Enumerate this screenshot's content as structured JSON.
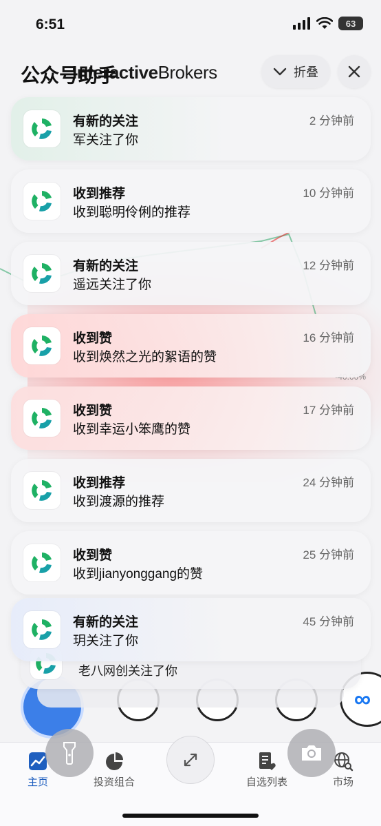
{
  "status_bar": {
    "time": "6:51",
    "battery": "63"
  },
  "background_app": {
    "brand_prefix": "Inter",
    "brand_bold": "active",
    "brand_suffix": "Brokers",
    "percent_label": "-40.00%",
    "meta_logo": "∞"
  },
  "header": {
    "title": "公众号助手",
    "collapse_label": "折叠",
    "collapse_icon": "chevron-down-icon",
    "close_icon": "close-icon"
  },
  "notifications": [
    {
      "title": "有新的关注",
      "body": "军关注了你",
      "time": "2 分钟前"
    },
    {
      "title": "收到推荐",
      "body": "收到聪明伶俐的推荐",
      "time": "10 分钟前"
    },
    {
      "title": "有新的关注",
      "body": "遥远关注了你",
      "time": "12 分钟前"
    },
    {
      "title": "收到赞",
      "body": "收到焕然之光的絮语的赞",
      "time": "16 分钟前"
    },
    {
      "title": "收到赞",
      "body": "收到幸运小笨鹰的赞",
      "time": "17 分钟前"
    },
    {
      "title": "收到推荐",
      "body": "收到渡源的推荐",
      "time": "24 分钟前"
    },
    {
      "title": "收到赞",
      "body": "收到jianyonggang的赞",
      "time": "25 分钟前"
    },
    {
      "title": "有新的关注",
      "body": "玥关注了你",
      "time": "45 分钟前"
    }
  ],
  "stacked": [
    {
      "body": "老八网创关注了你"
    }
  ],
  "tab_bar": {
    "tabs": [
      {
        "label": "主页",
        "icon": "chart-trend-icon",
        "active": true
      },
      {
        "label": "投资组合",
        "icon": "pie-chart-icon",
        "active": false
      },
      {
        "label": "自选列表",
        "icon": "watchlist-icon",
        "active": false
      },
      {
        "label": "市场",
        "icon": "globe-search-icon",
        "active": false
      }
    ]
  },
  "lock_controls": {
    "flashlight_icon": "flashlight-icon",
    "camera_icon": "camera-icon",
    "expand_icon": "expand-arrows-icon"
  },
  "colors": {
    "app_icon_green": "#1fb164",
    "app_icon_teal": "#18a0a8",
    "active_tab": "#1f5fbf",
    "accent_red": "#e83030"
  }
}
